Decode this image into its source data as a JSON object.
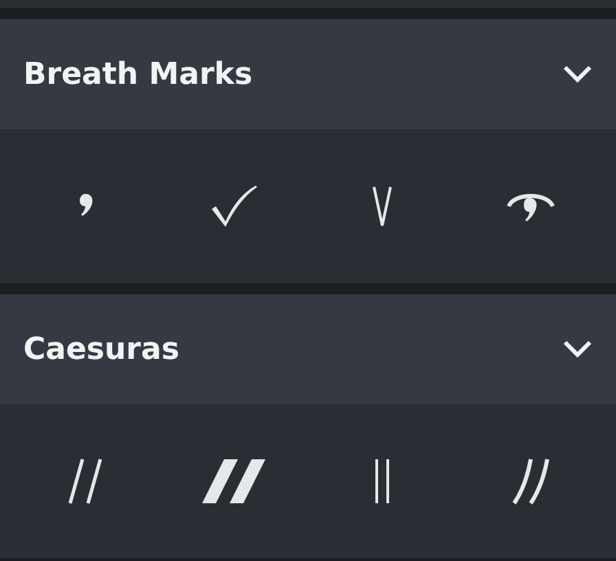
{
  "sections": [
    {
      "title": "Breath Marks",
      "expanded": true,
      "items": [
        {
          "kind": "comma"
        },
        {
          "kind": "tick"
        },
        {
          "kind": "upbow"
        },
        {
          "kind": "salzedo"
        }
      ]
    },
    {
      "title": "Caesuras",
      "expanded": true,
      "items": [
        {
          "kind": "thin"
        },
        {
          "kind": "thick"
        },
        {
          "kind": "straight"
        },
        {
          "kind": "curved"
        }
      ]
    }
  ]
}
